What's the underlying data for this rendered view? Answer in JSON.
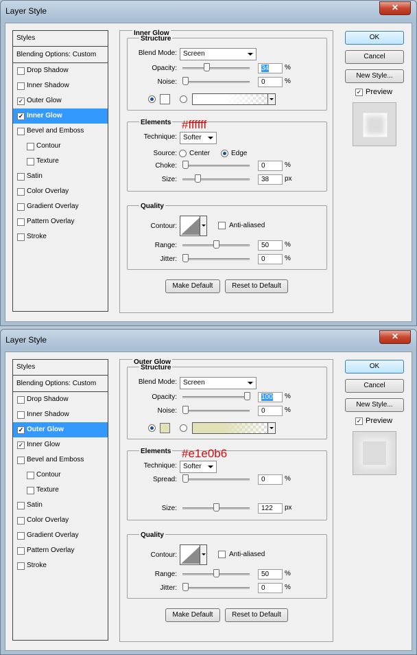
{
  "dialogs": [
    {
      "title": "Layer Style",
      "close_label": "✕",
      "styles_header": "Styles",
      "blending_options": "Blending Options: Custom",
      "list": [
        {
          "label": "Drop Shadow",
          "checked": false,
          "sub": false,
          "selected": false
        },
        {
          "label": "Inner Shadow",
          "checked": false,
          "sub": false,
          "selected": false
        },
        {
          "label": "Outer Glow",
          "checked": true,
          "sub": false,
          "selected": false
        },
        {
          "label": "Inner Glow",
          "checked": true,
          "sub": false,
          "selected": true
        },
        {
          "label": "Bevel and Emboss",
          "checked": false,
          "sub": false,
          "selected": false
        },
        {
          "label": "Contour",
          "checked": false,
          "sub": true,
          "selected": false
        },
        {
          "label": "Texture",
          "checked": false,
          "sub": true,
          "selected": false
        },
        {
          "label": "Satin",
          "checked": false,
          "sub": false,
          "selected": false
        },
        {
          "label": "Color Overlay",
          "checked": false,
          "sub": false,
          "selected": false
        },
        {
          "label": "Gradient Overlay",
          "checked": false,
          "sub": false,
          "selected": false
        },
        {
          "label": "Pattern Overlay",
          "checked": false,
          "sub": false,
          "selected": false
        },
        {
          "label": "Stroke",
          "checked": false,
          "sub": false,
          "selected": false
        }
      ],
      "panel_title": "Inner Glow",
      "structure": {
        "title": "Structure",
        "blend_mode_label": "Blend Mode:",
        "blend_mode": "Screen",
        "opacity_label": "Opacity:",
        "opacity": "34",
        "opacity_fraction": 0.34,
        "opacity_highlighted": true,
        "noise_label": "Noise:",
        "noise": "0",
        "noise_fraction": 0,
        "percent": "%",
        "solid_selected": true,
        "glow_color": "#ffffff"
      },
      "elements": {
        "title": "Elements",
        "annotation": "#ffffff",
        "technique_label": "Technique:",
        "technique": "Softer",
        "has_source": true,
        "source_label": "Source:",
        "source_center": "Center",
        "source_edge": "Edge",
        "source_selected": "edge",
        "row1_label": "Choke:",
        "row1_value": "0",
        "row1_fraction": 0,
        "row1_unit": "%",
        "size_label": "Size:",
        "size": "38",
        "size_fraction": 0.2,
        "size_unit": "px"
      },
      "quality": {
        "title": "Quality",
        "contour_label": "Contour:",
        "anti_aliased_label": "Anti-aliased",
        "range_label": "Range:",
        "range": "50",
        "range_fraction": 0.5,
        "jitter_label": "Jitter:",
        "jitter": "0",
        "jitter_fraction": 0,
        "percent": "%"
      },
      "buttons": {
        "make_default": "Make Default",
        "reset_default": "Reset to Default"
      },
      "side": {
        "ok": "OK",
        "cancel": "Cancel",
        "new_style": "New Style...",
        "preview_label": "Preview",
        "preview_checked": true
      }
    },
    {
      "title": "Layer Style",
      "close_label": "✕",
      "styles_header": "Styles",
      "blending_options": "Blending Options: Custom",
      "list": [
        {
          "label": "Drop Shadow",
          "checked": false,
          "sub": false,
          "selected": false
        },
        {
          "label": "Inner Shadow",
          "checked": false,
          "sub": false,
          "selected": false
        },
        {
          "label": "Outer Glow",
          "checked": true,
          "sub": false,
          "selected": true
        },
        {
          "label": "Inner Glow",
          "checked": true,
          "sub": false,
          "selected": false
        },
        {
          "label": "Bevel and Emboss",
          "checked": false,
          "sub": false,
          "selected": false
        },
        {
          "label": "Contour",
          "checked": false,
          "sub": true,
          "selected": false
        },
        {
          "label": "Texture",
          "checked": false,
          "sub": true,
          "selected": false
        },
        {
          "label": "Satin",
          "checked": false,
          "sub": false,
          "selected": false
        },
        {
          "label": "Color Overlay",
          "checked": false,
          "sub": false,
          "selected": false
        },
        {
          "label": "Gradient Overlay",
          "checked": false,
          "sub": false,
          "selected": false
        },
        {
          "label": "Pattern Overlay",
          "checked": false,
          "sub": false,
          "selected": false
        },
        {
          "label": "Stroke",
          "checked": false,
          "sub": false,
          "selected": false
        }
      ],
      "panel_title": "Outer Glow",
      "structure": {
        "title": "Structure",
        "blend_mode_label": "Blend Mode:",
        "blend_mode": "Screen",
        "opacity_label": "Opacity:",
        "opacity": "100",
        "opacity_fraction": 1,
        "opacity_highlighted": true,
        "noise_label": "Noise:",
        "noise": "0",
        "noise_fraction": 0,
        "percent": "%",
        "solid_selected": true,
        "glow_color": "#e1e0b6"
      },
      "elements": {
        "title": "Elements",
        "annotation": "#e1e0b6",
        "technique_label": "Technique:",
        "technique": "Softer",
        "has_source": false,
        "row1_label": "Spread:",
        "row1_value": "0",
        "row1_fraction": 0,
        "row1_unit": "%",
        "size_label": "Size:",
        "size": "122",
        "size_fraction": 0.5,
        "size_unit": "px"
      },
      "quality": {
        "title": "Quality",
        "contour_label": "Contour:",
        "anti_aliased_label": "Anti-aliased",
        "range_label": "Range:",
        "range": "50",
        "range_fraction": 0.5,
        "jitter_label": "Jitter:",
        "jitter": "0",
        "jitter_fraction": 0,
        "percent": "%"
      },
      "buttons": {
        "make_default": "Make Default",
        "reset_default": "Reset to Default"
      },
      "side": {
        "ok": "OK",
        "cancel": "Cancel",
        "new_style": "New Style...",
        "preview_label": "Preview",
        "preview_checked": true
      }
    }
  ]
}
